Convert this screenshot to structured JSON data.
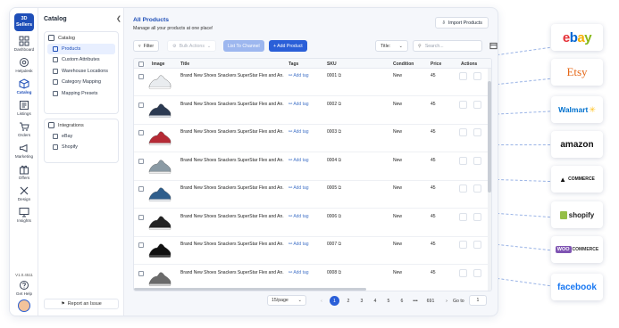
{
  "app": {
    "logo_text": "3D\nSellers",
    "rail": [
      {
        "label": "Dashboard",
        "icon": "dashboard-icon"
      },
      {
        "label": "Helpdesk",
        "icon": "helpdesk-icon"
      },
      {
        "label": "Catalog",
        "icon": "catalog-icon"
      },
      {
        "label": "Listings",
        "icon": "listings-icon"
      },
      {
        "label": "Orders",
        "icon": "orders-icon"
      },
      {
        "label": "Marketing",
        "icon": "marketing-icon"
      },
      {
        "label": "Offers",
        "icon": "offers-icon"
      },
      {
        "label": "Design",
        "icon": "design-icon"
      },
      {
        "label": "Insights",
        "icon": "insights-icon"
      }
    ],
    "version": "V1.0.4511",
    "get_help": "Get Help"
  },
  "sidebar": {
    "title": "Catalog",
    "catalog_group": "Catalog",
    "catalog_items": [
      "Products",
      "Custom Attributes",
      "Warehouse Locations",
      "Category Mapping",
      "Mapping Presets"
    ],
    "integrations_group": "Integrations",
    "integration_items": [
      "eBay",
      "Shopify"
    ],
    "report_issue": "Report an Issue"
  },
  "main": {
    "title": "All Products",
    "subtitle": "Manage all your products at one place!",
    "import_label": "Import Products",
    "toolbar": {
      "filter": "Filter",
      "bulk_actions": "Bulk Actions",
      "list_to_channel": "List To Channel",
      "add_product": "+ Add Product",
      "title_select": "Title:",
      "search_placeholder": "Search..."
    },
    "columns": [
      "Image",
      "Title",
      "Tags",
      "SKU",
      "Condition",
      "Price",
      "Actions"
    ],
    "rows": [
      {
        "title": "Brand New Shoes Snackers SuperStar Flex and An...",
        "tag": "Add tag",
        "sku": "0001",
        "condition": "New",
        "price": "45",
        "shoe_color": "#e9ecef",
        "accent": "#ffffff"
      },
      {
        "title": "Brand New Shoes Snackers SuperStar Flex and An...",
        "tag": "Add tag",
        "sku": "0002",
        "condition": "New",
        "price": "45",
        "shoe_color": "#2b3a52",
        "accent": "#d7dde6"
      },
      {
        "title": "Brand New Shoes Snackers SuperStar Flex and An...",
        "tag": "Add tag",
        "sku": "0003",
        "condition": "New",
        "price": "45",
        "shoe_color": "#b52a35",
        "accent": "#f1f1f1"
      },
      {
        "title": "Brand New Shoes Snackers SuperStar Flex and An...",
        "tag": "Add tag",
        "sku": "0004",
        "condition": "New",
        "price": "45",
        "shoe_color": "#8a9aa4",
        "accent": "#eeeeee"
      },
      {
        "title": "Brand New Shoes Snackers SuperStar Flex and An...",
        "tag": "Add tag",
        "sku": "0005",
        "condition": "New",
        "price": "45",
        "shoe_color": "#2f5e8c",
        "accent": "#e9eef3"
      },
      {
        "title": "Brand New Shoes Snackers SuperStar Flex and An...",
        "tag": "Add tag",
        "sku": "0006",
        "condition": "New",
        "price": "45",
        "shoe_color": "#222222",
        "accent": "#f4f4f4"
      },
      {
        "title": "Brand New Shoes Snackers SuperStar Flex and An...",
        "tag": "Add tag",
        "sku": "0007",
        "condition": "New",
        "price": "45",
        "shoe_color": "#111111",
        "accent": "#3a3a3a"
      },
      {
        "title": "Brand New Shoes Snackers SuperStar Flex and An...",
        "tag": "Add tag",
        "sku": "0008",
        "condition": "New",
        "price": "45",
        "shoe_color": "#6b6b6b",
        "accent": "#d9d9d9"
      }
    ],
    "pagination": {
      "per_page": "15/page",
      "pages": [
        "1",
        "2",
        "3",
        "4",
        "5",
        "6"
      ],
      "ellipsis": "•••",
      "last_page": "691",
      "active_page": "1",
      "goto_label": "Go to",
      "goto_value": "1"
    }
  },
  "marketplaces": [
    {
      "name": "ebay",
      "color": "#e53238"
    },
    {
      "name": "Etsy",
      "color": "#e56717"
    },
    {
      "name": "Walmart",
      "color": "#0071ce"
    },
    {
      "name": "amazon",
      "color": "#111111"
    },
    {
      "name": "COMMERCE",
      "color": "#121212"
    },
    {
      "name": "shopify",
      "color": "#5e8e3e"
    },
    {
      "name": "COMMERCE",
      "color": "#7f54b3"
    },
    {
      "name": "facebook",
      "color": "#1877f2"
    }
  ],
  "colors": {
    "accent": "#2a5fd8",
    "brand": "#1f4fb8"
  }
}
